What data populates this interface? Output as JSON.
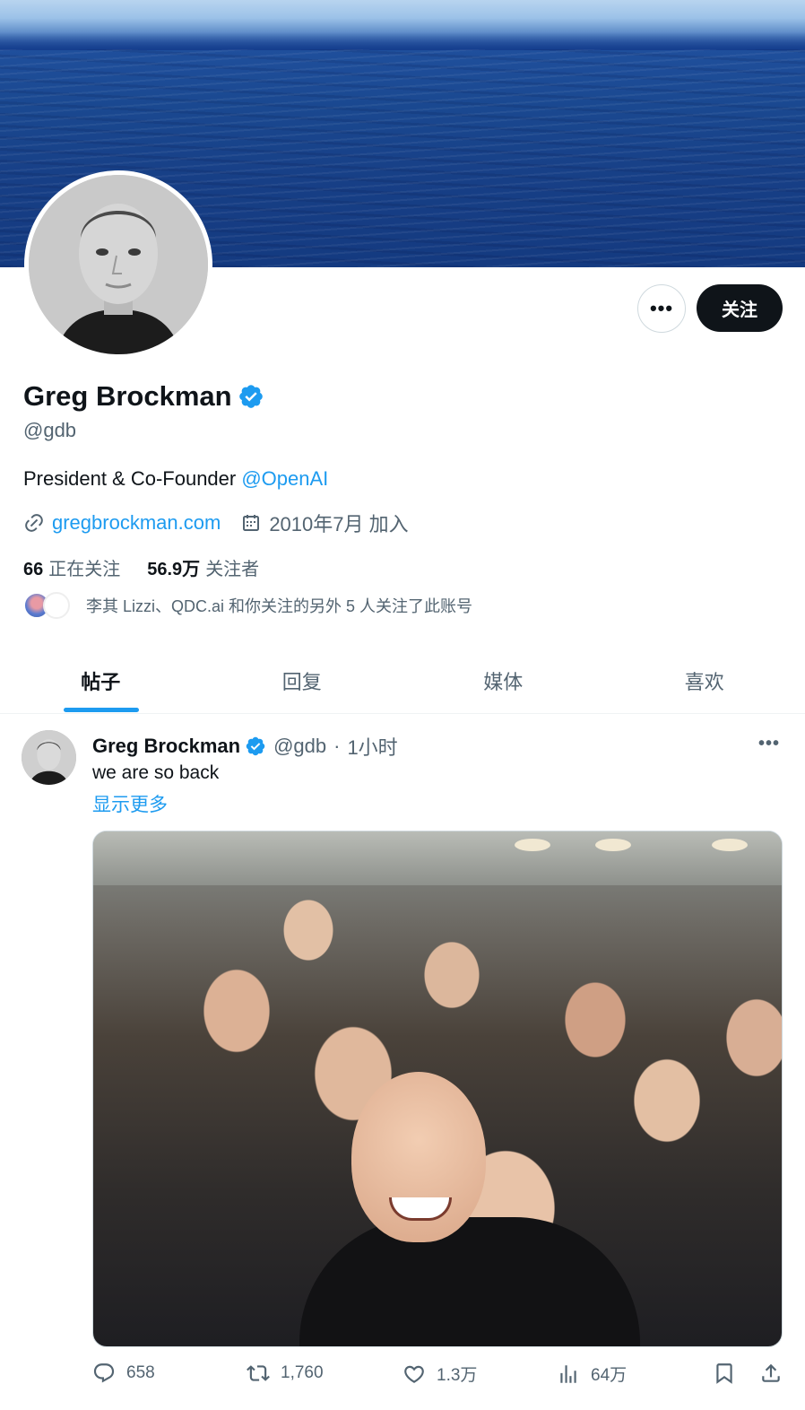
{
  "profile": {
    "display_name": "Greg Brockman",
    "handle": "@gdb",
    "bio_text": "President & Co-Founder ",
    "bio_mention": "@OpenAI",
    "website": "gregbrockman.com",
    "joined": "2010年7月 加入",
    "following_count": "66",
    "following_label": "正在关注",
    "followers_count": "56.9万",
    "followers_label": "关注者",
    "followed_by_text": "李其 Lizzi、QDC.ai 和你关注的另外 5 人关注了此账号"
  },
  "buttons": {
    "more_label": "•••",
    "follow_label": "关注"
  },
  "tabs": [
    {
      "label": "帖子",
      "active": true
    },
    {
      "label": "回复",
      "active": false
    },
    {
      "label": "媒体",
      "active": false
    },
    {
      "label": "喜欢",
      "active": false
    }
  ],
  "post": {
    "author_name": "Greg Brockman",
    "author_handle": "@gdb",
    "separator": "·",
    "time": "1小时",
    "more_label": "•••",
    "text": "we are so back",
    "show_more": "显示更多",
    "replies": "658",
    "reposts": "1,760",
    "likes": "1.3万",
    "views": "64万"
  },
  "colors": {
    "accent": "#1d9bf0",
    "text_primary": "#0f1419",
    "text_secondary": "#536471",
    "follow_button_bg": "#0f1419"
  }
}
